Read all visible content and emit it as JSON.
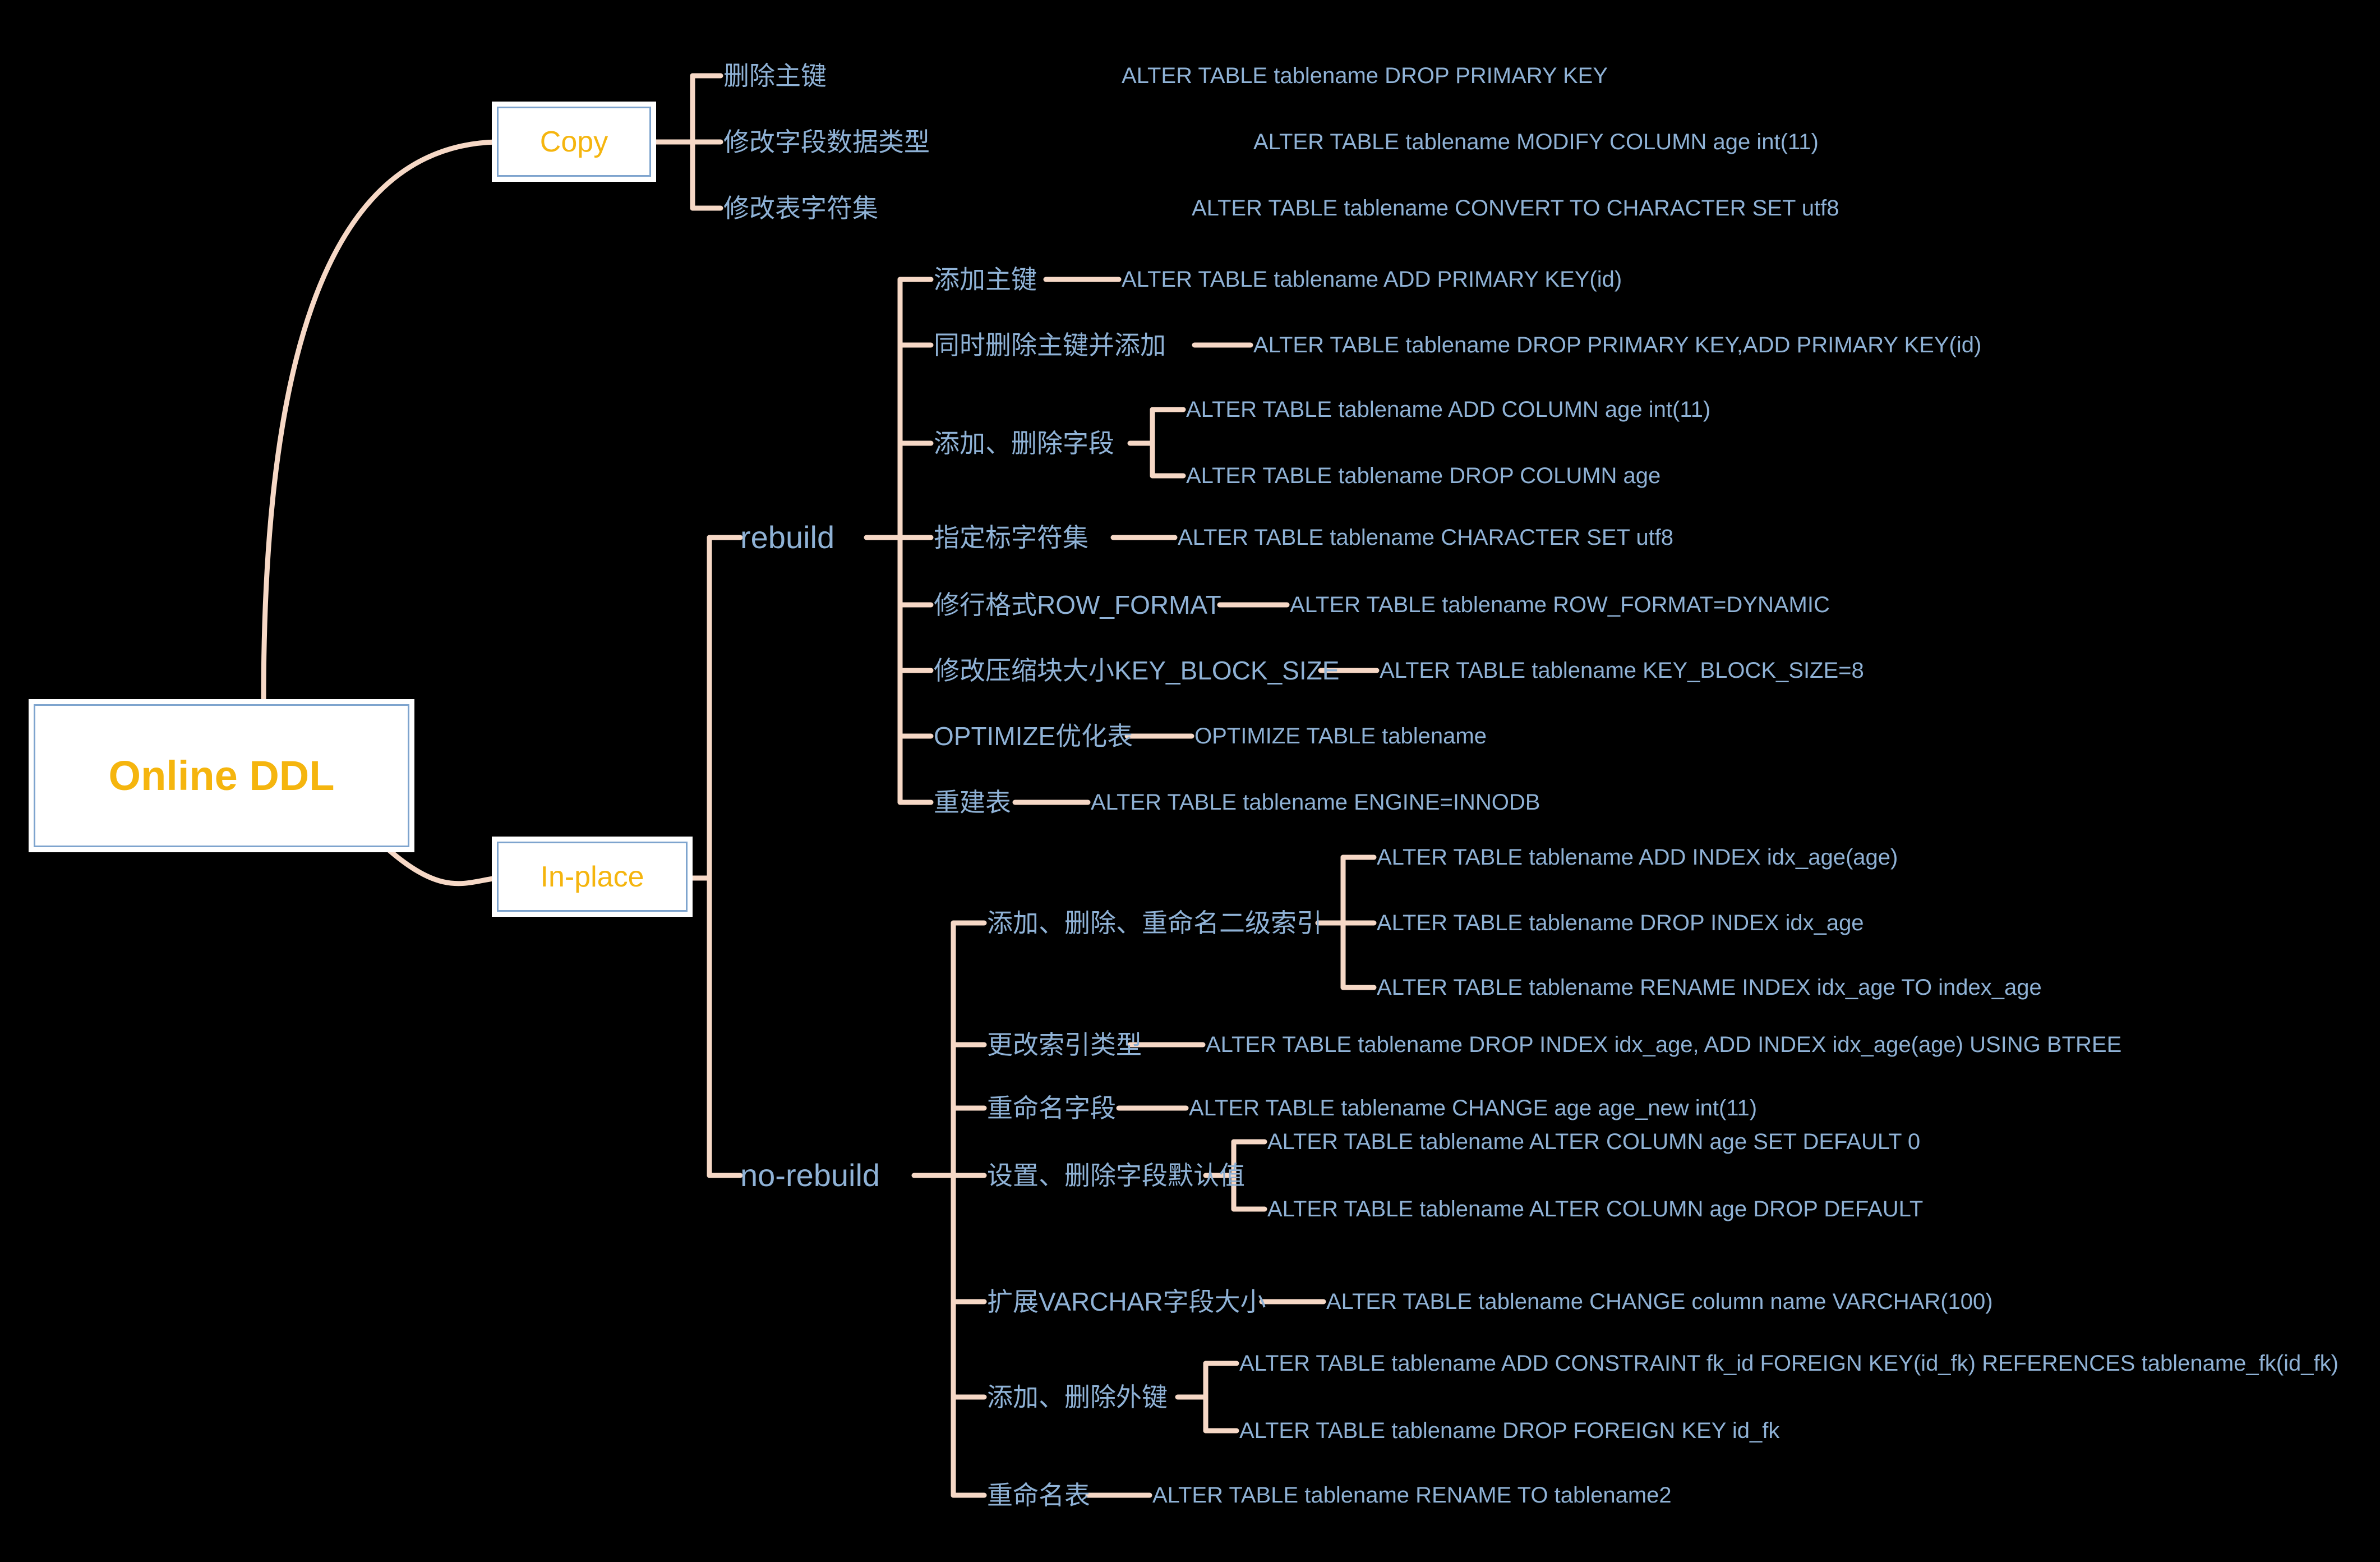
{
  "theme": {
    "background": "#000000",
    "connector_color": "#F6D8C6",
    "text_blue": "#8FB2D6",
    "node_text_orange": "#F5B50E",
    "node_border_blue": "#7EA4CE",
    "node_fill": "#FFFFFF"
  },
  "root": {
    "label": "Online DDL"
  },
  "branches": {
    "copy": {
      "label": "Copy"
    },
    "inplace": {
      "label": "In-place"
    },
    "rebuild": {
      "label": "rebuild"
    },
    "norebuild": {
      "label": "no-rebuild"
    }
  },
  "copy_items": [
    {
      "topic": "删除主键",
      "sql": [
        "ALTER TABLE tablename DROP PRIMARY KEY"
      ]
    },
    {
      "topic": "修改字段数据类型",
      "sql": [
        "ALTER TABLE tablename MODIFY COLUMN age int(11)"
      ]
    },
    {
      "topic": "修改表字符集",
      "sql": [
        "ALTER TABLE tablename CONVERT TO CHARACTER SET utf8"
      ]
    }
  ],
  "rebuild_items": [
    {
      "topic": "添加主键",
      "sql": [
        "ALTER TABLE tablename ADD PRIMARY KEY(id)"
      ]
    },
    {
      "topic": "同时删除主键并添加",
      "sql": [
        "ALTER TABLE tablename DROP PRIMARY KEY,ADD PRIMARY KEY(id)"
      ]
    },
    {
      "topic": "添加、删除字段",
      "sql": [
        "ALTER TABLE tablename ADD COLUMN age int(11)",
        "ALTER TABLE tablename DROP COLUMN age"
      ]
    },
    {
      "topic": "指定标字符集",
      "sql": [
        "ALTER TABLE tablename CHARACTER SET utf8"
      ]
    },
    {
      "topic": "修行格式ROW_FORMAT",
      "sql": [
        "ALTER TABLE tablename ROW_FORMAT=DYNAMIC"
      ]
    },
    {
      "topic": "修改压缩块大小KEY_BLOCK_SIZE",
      "sql": [
        "ALTER TABLE tablename KEY_BLOCK_SIZE=8"
      ]
    },
    {
      "topic": "OPTIMIZE优化表",
      "sql": [
        "OPTIMIZE TABLE tablename"
      ]
    },
    {
      "topic": "重建表",
      "sql": [
        "ALTER TABLE tablename ENGINE=INNODB"
      ]
    }
  ],
  "norebuild_items": [
    {
      "topic": "添加、删除、重命名二级索引",
      "sql": [
        "ALTER TABLE tablename ADD INDEX idx_age(age)",
        "ALTER TABLE tablename DROP INDEX idx_age",
        "ALTER TABLE tablename RENAME INDEX idx_age TO index_age"
      ]
    },
    {
      "topic": "更改索引类型",
      "sql": [
        "ALTER TABLE tablename DROP INDEX idx_age, ADD INDEX idx_age(age) USING BTREE"
      ]
    },
    {
      "topic": "重命名字段",
      "sql": [
        "ALTER TABLE tablename CHANGE age age_new int(11)"
      ]
    },
    {
      "topic": "设置、删除字段默认值",
      "sql": [
        "ALTER TABLE tablename ALTER COLUMN age SET DEFAULT 0",
        "ALTER TABLE tablename ALTER COLUMN age DROP DEFAULT"
      ]
    },
    {
      "topic": "扩展VARCHAR字段大小",
      "sql": [
        "ALTER TABLE tablename CHANGE column name VARCHAR(100)"
      ]
    },
    {
      "topic": "添加、删除外键",
      "sql": [
        "ALTER TABLE tablename ADD CONSTRAINT fk_id FOREIGN KEY(id_fk) REFERENCES tablename_fk(id_fk)",
        "ALTER TABLE tablename DROP FOREIGN KEY id_fk"
      ]
    },
    {
      "topic": "重命名表",
      "sql": [
        "ALTER TABLE tablename RENAME TO tablename2"
      ]
    }
  ]
}
